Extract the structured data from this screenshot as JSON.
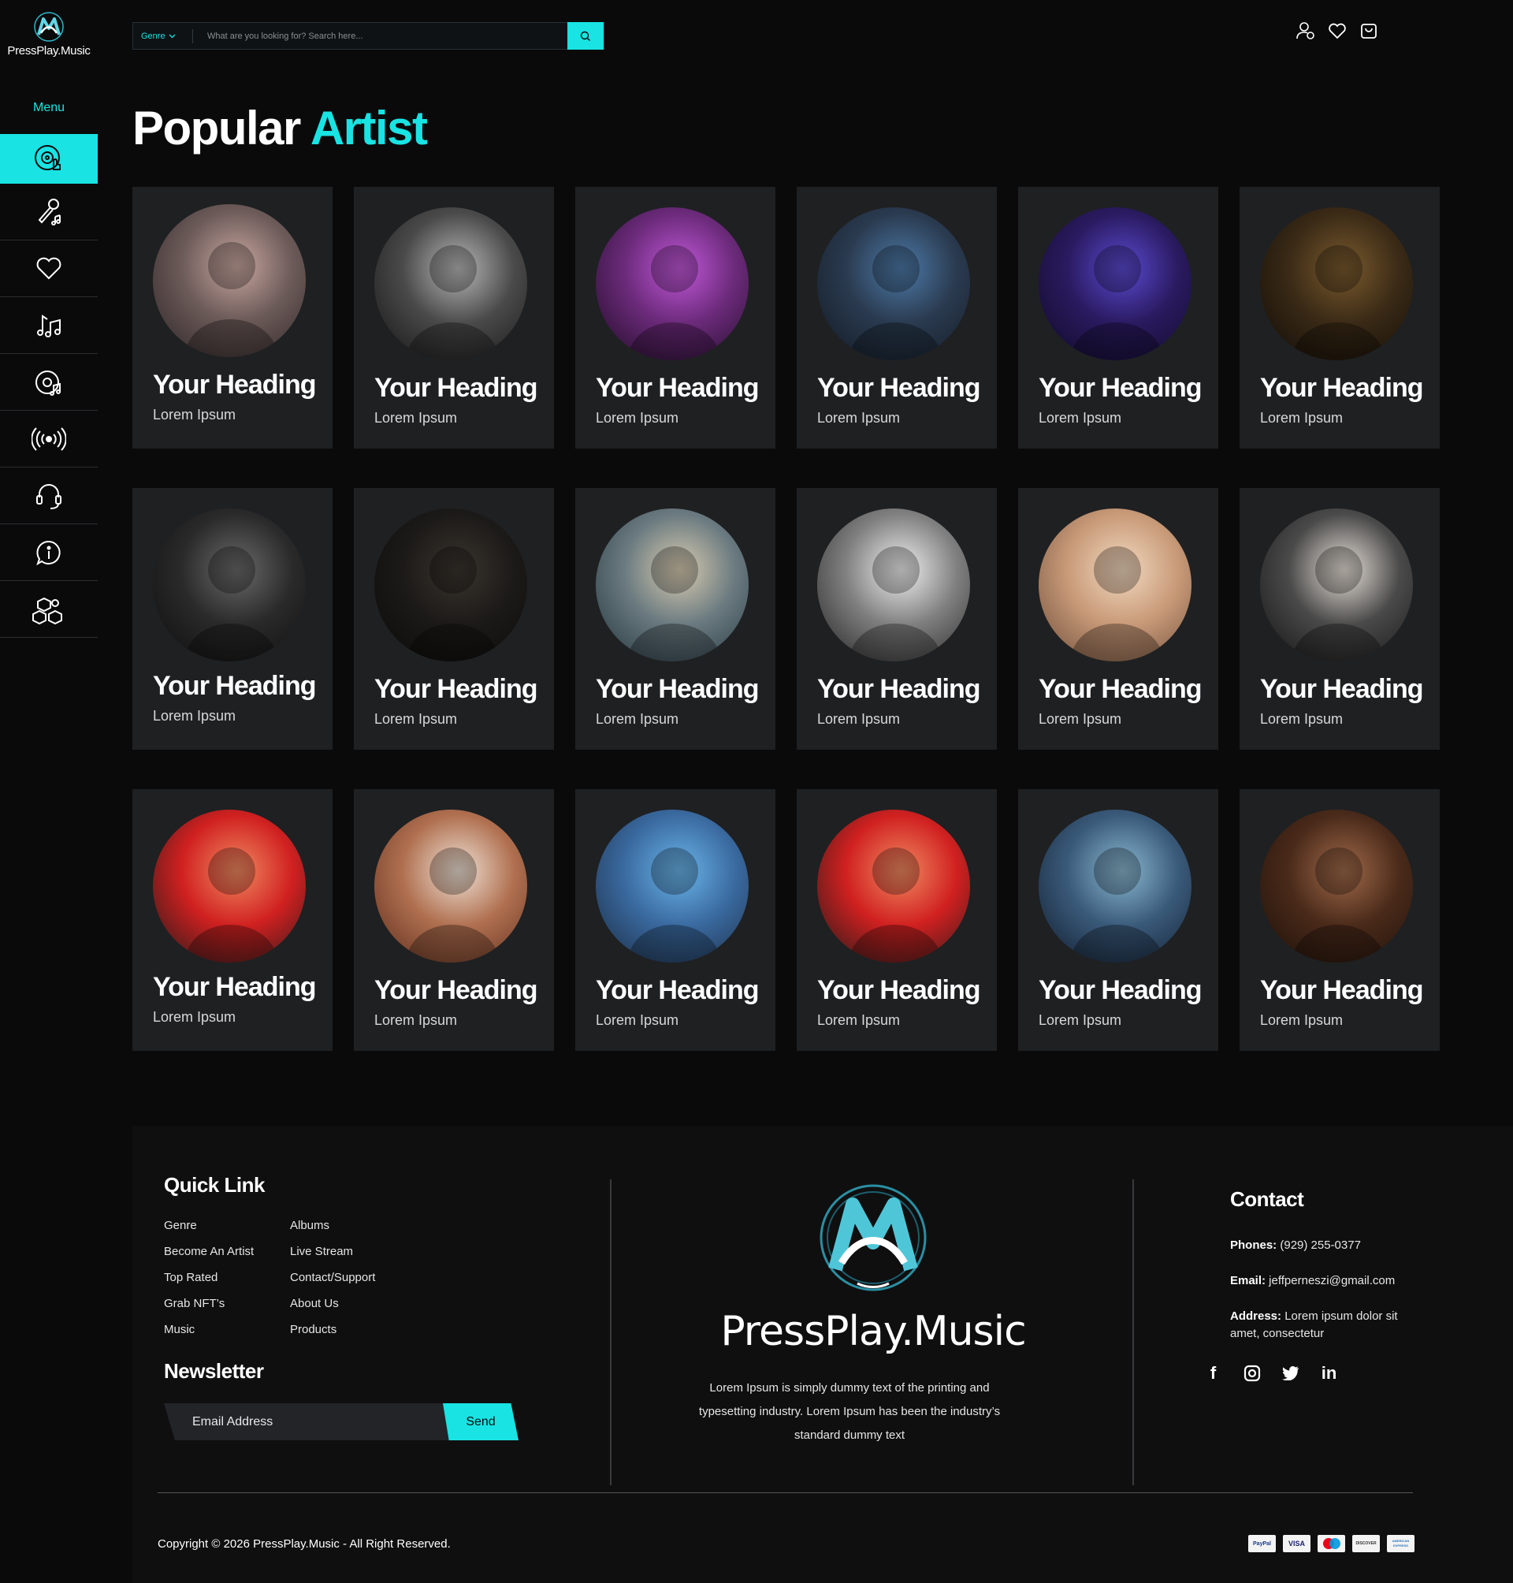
{
  "brand": {
    "name": "PressPlay.Music",
    "accent": "#19e3e3"
  },
  "sidebar": {
    "menu_label": "Menu",
    "items": [
      {
        "icon": "vinyl-hand-icon",
        "active": true
      },
      {
        "icon": "microphone-notes-icon"
      },
      {
        "icon": "heart-icon"
      },
      {
        "icon": "music-notes-icon"
      },
      {
        "icon": "disc-note-icon"
      },
      {
        "icon": "broadcast-icon"
      },
      {
        "icon": "headset-icon"
      },
      {
        "icon": "info-chat-icon"
      },
      {
        "icon": "boxes-icon"
      }
    ]
  },
  "header": {
    "genre_label": "Genre",
    "search_placeholder": "What are you looking for? Search here...",
    "icons": [
      "user-icon",
      "heart-icon",
      "cart-icon"
    ]
  },
  "page": {
    "title_main": "Popular",
    "title_accent": "Artist"
  },
  "artists": [
    {
      "heading": "Your Heading",
      "sub": "Lorem Ipsum"
    },
    {
      "heading": "Your Heading",
      "sub": "Lorem Ipsum"
    },
    {
      "heading": "Your Heading",
      "sub": "Lorem Ipsum"
    },
    {
      "heading": "Your Heading",
      "sub": "Lorem Ipsum"
    },
    {
      "heading": "Your Heading",
      "sub": "Lorem Ipsum"
    },
    {
      "heading": "Your Heading",
      "sub": "Lorem Ipsum"
    },
    {
      "heading": "Your Heading",
      "sub": "Lorem Ipsum"
    },
    {
      "heading": "Your Heading",
      "sub": "Lorem Ipsum"
    },
    {
      "heading": "Your Heading",
      "sub": "Lorem Ipsum"
    },
    {
      "heading": "Your Heading",
      "sub": "Lorem Ipsum"
    },
    {
      "heading": "Your Heading",
      "sub": "Lorem Ipsum"
    },
    {
      "heading": "Your Heading",
      "sub": "Lorem Ipsum"
    },
    {
      "heading": "Your Heading",
      "sub": "Lorem Ipsum"
    },
    {
      "heading": "Your Heading",
      "sub": "Lorem Ipsum"
    },
    {
      "heading": "Your Heading",
      "sub": "Lorem Ipsum"
    },
    {
      "heading": "Your Heading",
      "sub": "Lorem Ipsum"
    },
    {
      "heading": "Your Heading",
      "sub": "Lorem Ipsum"
    },
    {
      "heading": "Your Heading",
      "sub": "Lorem Ipsum"
    }
  ],
  "footer": {
    "quick_link_title": "Quick Link",
    "links_col1": [
      "Genre",
      "Become An Artist",
      "Top Rated",
      "Grab NFT’s",
      "Music"
    ],
    "links_col2": [
      "Albums",
      "Live Stream",
      "Contact/Support",
      "About Us",
      "Products"
    ],
    "newsletter_title": "Newsletter",
    "newsletter_placeholder": "Email Address",
    "newsletter_send": "Send",
    "about": "Lorem Ipsum is simply dummy text of the printing and typesetting industry. Lorem Ipsum has been the industry’s standard dummy text",
    "contact_title": "Contact",
    "phones_label": "Phones:",
    "phones_value": " (929) 255-0377",
    "email_label": "Email:",
    "email_value": " jeffperneszi@gmail.com",
    "address_label": "Address:",
    "address_value": " Lorem ipsum dolor sit amet, consectetur",
    "social": [
      "facebook-icon",
      "instagram-icon",
      "twitter-icon",
      "linkedin-icon"
    ],
    "copyright": "Copyright © 2026 PressPlay.Music - All Right Reserved.",
    "payments": [
      "PayPal",
      "VISA",
      "",
      "DISCOVER",
      "AMERICAN EXPRESS"
    ]
  }
}
